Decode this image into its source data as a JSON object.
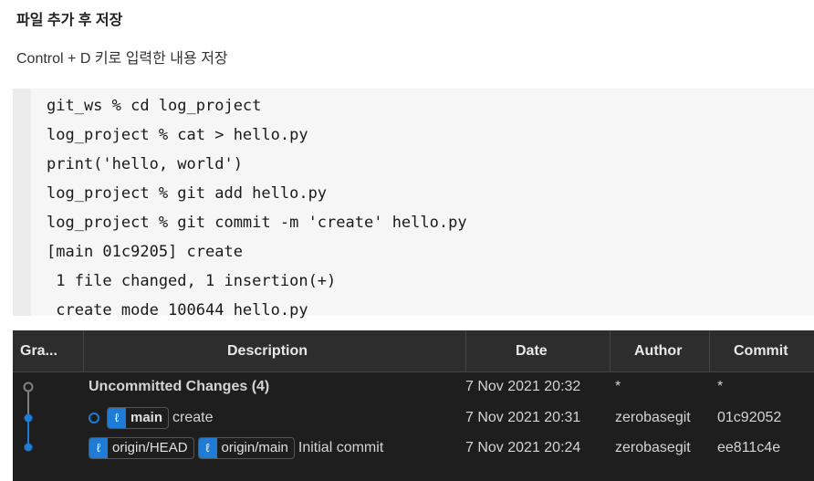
{
  "doc": {
    "heading": "파일 추가 후 저장",
    "description": "Control + D 키로 입력한 내용 저장",
    "code_lines": [
      "git_ws % cd log_project",
      "log_project % cat > hello.py",
      "print('hello, world')",
      "log_project % git add hello.py",
      "log_project % git commit -m 'create' hello.py",
      "[main 01c9205] create",
      " 1 file changed, 1 insertion(+)",
      " create mode 100644 hello.py"
    ]
  },
  "git_log": {
    "columns": {
      "graph": "Gra...",
      "description": "Description",
      "date": "Date",
      "author": "Author",
      "commit": "Commit"
    },
    "rows": [
      {
        "description": "Uncommitted Changes (4)",
        "date": "7 Nov 2021 20:32",
        "author": "*",
        "commit": "*"
      },
      {
        "refs": [
          "main"
        ],
        "description": "create",
        "date": "7 Nov 2021 20:31",
        "author": "zerobasegit",
        "commit": "01c92052"
      },
      {
        "refs": [
          "origin/HEAD",
          "origin/main"
        ],
        "description": "Initial commit",
        "date": "7 Nov 2021 20:24",
        "author": "zerobasegit",
        "commit": "ee811c4e"
      }
    ],
    "colors": {
      "graph_line": "#1e7bd6",
      "uncommitted": "#808080",
      "ref_icon_bg": "#1e7bd6"
    },
    "icons": {
      "branch": "branch-icon"
    }
  }
}
